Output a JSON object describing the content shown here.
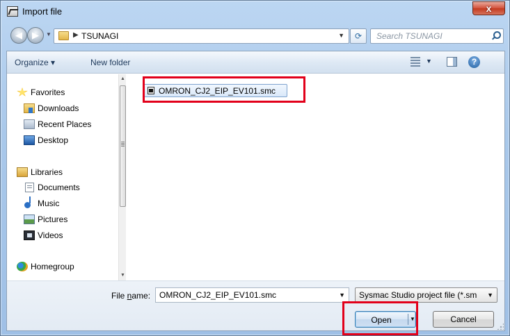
{
  "window": {
    "title": "Import file",
    "close_label": "x"
  },
  "nav": {
    "breadcrumb": "TSUNAGI",
    "search_placeholder": "Search TSUNAGI"
  },
  "toolbar": {
    "organize": "Organize ▾",
    "new_folder": "New folder"
  },
  "sidebar": {
    "items": [
      {
        "label": "Favorites",
        "icon": "star-icon"
      },
      {
        "label": "Downloads",
        "icon": "downloads-folder-icon"
      },
      {
        "label": "Recent Places",
        "icon": "recent-places-icon"
      },
      {
        "label": "Desktop",
        "icon": "desktop-icon"
      },
      {
        "label": "Libraries",
        "icon": "libraries-icon"
      },
      {
        "label": "Documents",
        "icon": "documents-icon"
      },
      {
        "label": "Music",
        "icon": "music-icon"
      },
      {
        "label": "Pictures",
        "icon": "pictures-icon"
      },
      {
        "label": "Videos",
        "icon": "videos-icon"
      },
      {
        "label": "Homegroup",
        "icon": "homegroup-icon"
      }
    ]
  },
  "files": [
    {
      "name": "OMRON_CJ2_EIP_EV101.smc",
      "icon": "smc-file-icon"
    }
  ],
  "bottom": {
    "file_name_label_prefix": "File ",
    "file_name_label_accel": "n",
    "file_name_label_suffix": "ame:",
    "file_name_value": "OMRON_CJ2_EIP_EV101.smc",
    "file_type_value": "Sysmac Studio project file (*.sm",
    "open_label": "Open",
    "cancel_label": "Cancel"
  },
  "colors": {
    "highlight": "#e2001a",
    "accent": "#3c7fb1"
  }
}
